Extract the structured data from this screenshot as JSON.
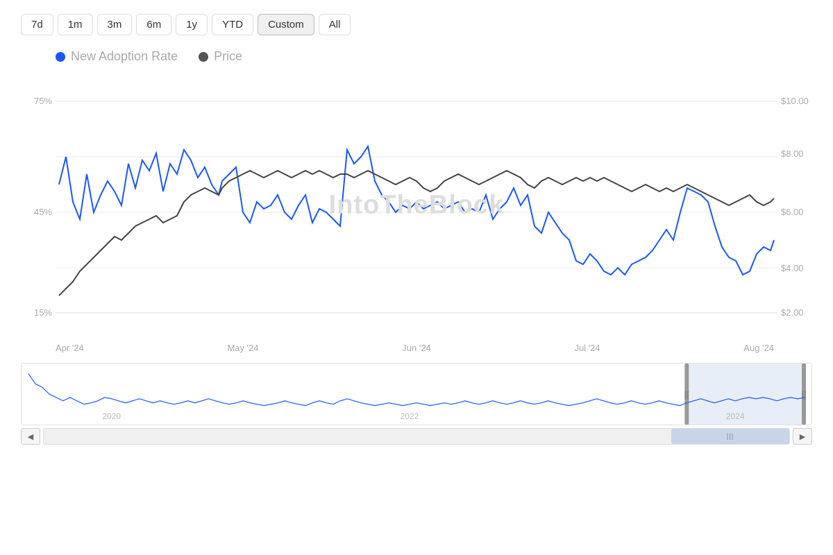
{
  "timeButtons": [
    {
      "label": "7d",
      "id": "7d"
    },
    {
      "label": "1m",
      "id": "1m"
    },
    {
      "label": "3m",
      "id": "3m"
    },
    {
      "label": "6m",
      "id": "6m"
    },
    {
      "label": "1y",
      "id": "1y"
    },
    {
      "label": "YTD",
      "id": "ytd"
    },
    {
      "label": "Custom",
      "id": "custom"
    },
    {
      "label": "All",
      "id": "all"
    }
  ],
  "activeButton": "custom",
  "legend": {
    "item1": {
      "label": "New Adoption Rate",
      "color": "blue"
    },
    "item2": {
      "label": "Price",
      "color": "dark"
    }
  },
  "yAxisLeft": [
    "75%",
    "45%",
    "15%"
  ],
  "yAxisRight": [
    "$10.00",
    "$8.00",
    "$6.00",
    "$4.00",
    "$2.00"
  ],
  "xAxisLabels": [
    "Apr '24",
    "May '24",
    "Jun '24",
    "Jul '24",
    "Aug '24"
  ],
  "miniXLabels": [
    "2020",
    "2022",
    "2024"
  ],
  "watermark": "IntoTheBlock",
  "scrollbar": {
    "leftArrow": "◀",
    "rightArrow": "▶",
    "handleIcon": "|||"
  }
}
